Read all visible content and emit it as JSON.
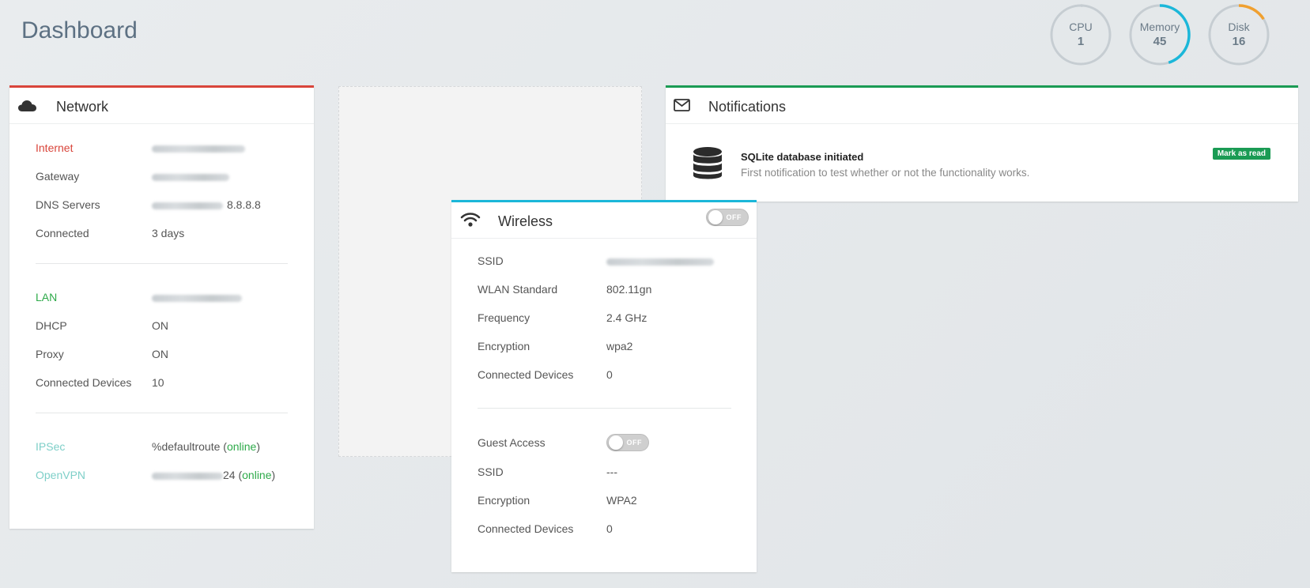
{
  "page": {
    "title": "Dashboard"
  },
  "gauges": [
    {
      "label": "CPU",
      "value": "1",
      "percent": 1,
      "color": "#c6cdd2"
    },
    {
      "label": "Memory",
      "value": "45",
      "percent": 45,
      "color": "#1bb7d9"
    },
    {
      "label": "Disk",
      "value": "16",
      "percent": 16,
      "color": "#f0a030"
    }
  ],
  "network": {
    "title": "Network",
    "accent": "#d9453b",
    "icon": "cloud-icon",
    "internet": {
      "label": "Internet",
      "label_color": "#d9453b",
      "gateway_label": "Gateway",
      "dns_label": "DNS Servers",
      "dns_value": "8.8.8.8",
      "connected_label": "Connected",
      "connected_value": "3 days"
    },
    "lan": {
      "label": "LAN",
      "label_color": "#2eaa4a",
      "dhcp_label": "DHCP",
      "dhcp_value": "ON",
      "proxy_label": "Proxy",
      "proxy_value": "ON",
      "devices_label": "Connected Devices",
      "devices_value": "10"
    },
    "vpn": {
      "label_color": "#7ecfc8",
      "ipsec_label": "IPSec",
      "ipsec_value": "%defaultroute",
      "ipsec_status": "online",
      "openvpn_label": "OpenVPN",
      "openvpn_value": "24",
      "openvpn_status": "online"
    }
  },
  "notifications": {
    "title": "Notifications",
    "accent": "#1a9b54",
    "icon": "envelope-icon",
    "items": [
      {
        "icon": "database-icon",
        "title": "SQLite database initiated",
        "text": "First notification to test whether or not the functionality works.",
        "action": "Mark as read"
      }
    ]
  },
  "wireless": {
    "title": "Wireless",
    "accent": "#1bb7d9",
    "icon": "wifi-icon",
    "toggle": "OFF",
    "ssid_label": "SSID",
    "standard_label": "WLAN Standard",
    "standard_value": "802.11gn",
    "frequency_label": "Frequency",
    "frequency_value": "2.4 GHz",
    "encryption_label": "Encryption",
    "encryption_value": "wpa2",
    "devices_label": "Connected Devices",
    "devices_value": "0",
    "guest": {
      "label": "Guest Access",
      "toggle": "OFF",
      "ssid_label": "SSID",
      "ssid_value": "---",
      "encryption_label": "Encryption",
      "encryption_value": "WPA2",
      "devices_label": "Connected Devices",
      "devices_value": "0"
    }
  }
}
